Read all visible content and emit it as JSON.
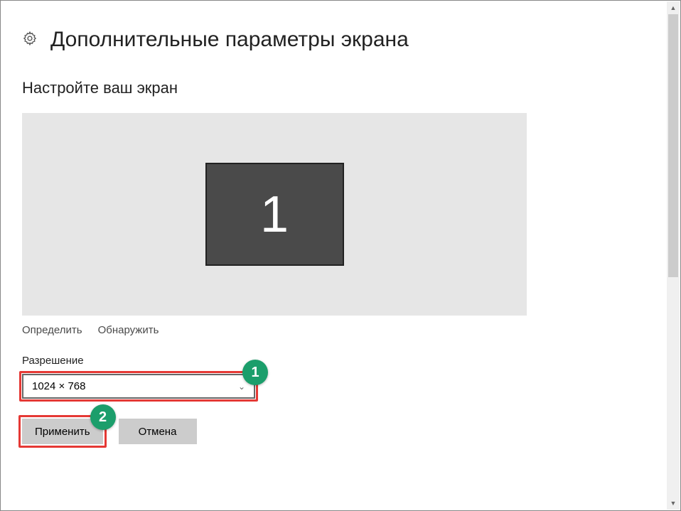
{
  "header": {
    "title": "Дополнительные параметры экрана"
  },
  "section": {
    "title": "Настройте ваш экран",
    "monitor_number": "1"
  },
  "links": {
    "identify": "Определить",
    "detect": "Обнаружить"
  },
  "resolution": {
    "label": "Разрешение",
    "value": "1024 × 768"
  },
  "buttons": {
    "apply": "Применить",
    "cancel": "Отмена"
  },
  "callouts": {
    "one": "1",
    "two": "2"
  }
}
